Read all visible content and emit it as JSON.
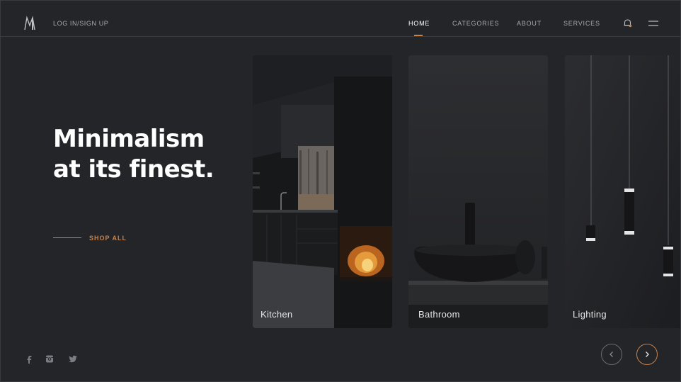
{
  "header": {
    "login_label": "LOG IN/SIGN UP",
    "nav": [
      "HOME",
      "CATEGORIES",
      "ABOUT",
      "SERVICES"
    ],
    "active_nav": "HOME"
  },
  "hero": {
    "title_line1": "Minimalism",
    "title_line2": "at its finest.",
    "shop_all_label": "SHOP ALL"
  },
  "cards": [
    {
      "label": "Kitchen"
    },
    {
      "label": "Bathroom"
    },
    {
      "label": "Lighting"
    }
  ],
  "icons": {
    "logo": "m-logo-icon",
    "cart": "bell-icon",
    "menu": "hamburger-icon",
    "social": [
      "facebook-icon",
      "instagram-icon",
      "twitter-icon"
    ],
    "prev": "chevron-left-icon",
    "next": "chevron-right-icon"
  },
  "colors": {
    "background": "#242528",
    "accent": "#c8824a",
    "text": "#ffffff",
    "muted_text": "#a9aab0"
  }
}
